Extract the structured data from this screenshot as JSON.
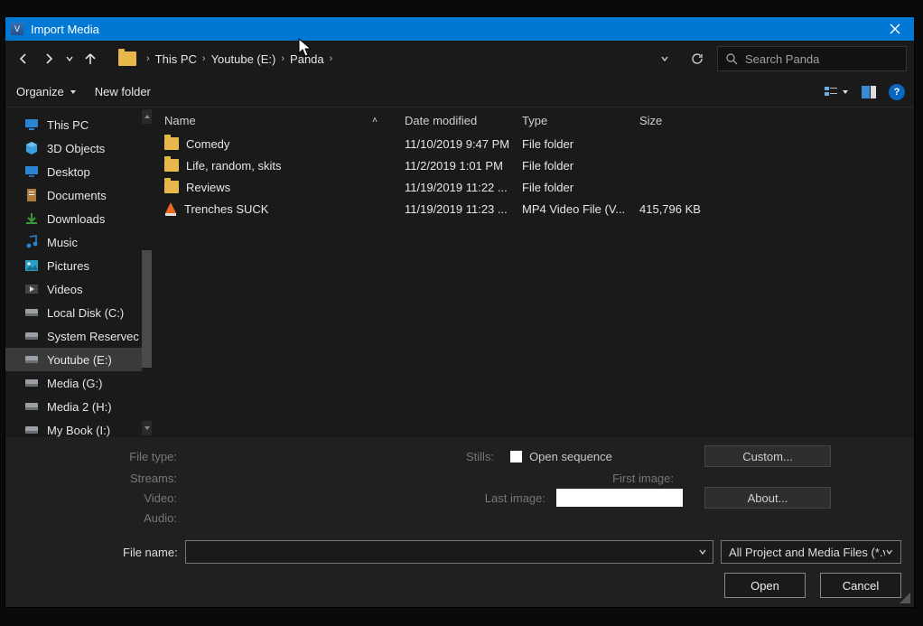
{
  "title": "Import Media",
  "breadcrumb": [
    "This PC",
    "Youtube (E:)",
    "Panda"
  ],
  "search_placeholder": "Search Panda",
  "toolbar": {
    "organize": "Organize",
    "newfolder": "New folder"
  },
  "columns": {
    "name": "Name",
    "date": "Date modified",
    "type": "Type",
    "size": "Size"
  },
  "sidebar": [
    {
      "label": "This PC",
      "icon": "pc"
    },
    {
      "label": "3D Objects",
      "icon": "3d"
    },
    {
      "label": "Desktop",
      "icon": "desktop"
    },
    {
      "label": "Documents",
      "icon": "docs"
    },
    {
      "label": "Downloads",
      "icon": "downloads"
    },
    {
      "label": "Music",
      "icon": "music"
    },
    {
      "label": "Pictures",
      "icon": "pictures"
    },
    {
      "label": "Videos",
      "icon": "videos"
    },
    {
      "label": "Local Disk (C:)",
      "icon": "disk"
    },
    {
      "label": "System Reservec",
      "icon": "disk"
    },
    {
      "label": "Youtube (E:)",
      "icon": "disk",
      "selected": true
    },
    {
      "label": "Media (G:)",
      "icon": "disk"
    },
    {
      "label": "Media 2 (H:)",
      "icon": "disk"
    },
    {
      "label": "My Book (I:)",
      "icon": "disk"
    }
  ],
  "rows": [
    {
      "name": "Comedy",
      "date": "11/10/2019 9:47 PM",
      "type": "File folder",
      "size": "",
      "icon": "folder"
    },
    {
      "name": "Life, random, skits",
      "date": "11/2/2019 1:01 PM",
      "type": "File folder",
      "size": "",
      "icon": "folder"
    },
    {
      "name": "Reviews",
      "date": "11/19/2019 11:22 ...",
      "type": "File folder",
      "size": "",
      "icon": "folder"
    },
    {
      "name": "Trenches SUCK",
      "date": "11/19/2019 11:23 ...",
      "type": "MP4 Video File (V...",
      "size": "415,796 KB",
      "icon": "vlc"
    }
  ],
  "meta": {
    "filetype": "File type:",
    "streams": "Streams:",
    "video": "Video:",
    "audio": "Audio:",
    "stills": "Stills:",
    "opensequence": "Open sequence",
    "firstimage": "First image:",
    "lastimage": "Last image:",
    "custom": "Custom...",
    "about": "About..."
  },
  "file": {
    "label": "File name:",
    "filter": "All Project and Media Files (*.ve"
  },
  "buttons": {
    "open": "Open",
    "cancel": "Cancel"
  },
  "help": "?"
}
